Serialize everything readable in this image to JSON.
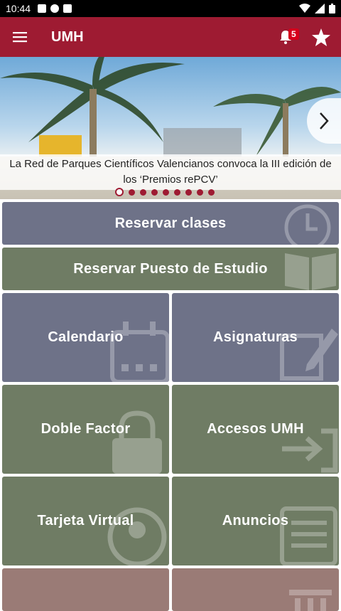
{
  "status_bar": {
    "time": "10:44"
  },
  "app_bar": {
    "title": "UMH",
    "notification_count": "5"
  },
  "carousel": {
    "caption": "La Red de Parques Científicos Valencianos convoca la III edición de los ‘Premios rePCV’",
    "dot_count": 9,
    "active_dot": 0
  },
  "tiles": {
    "reservar_clases": "Reservar clases",
    "reservar_puesto": "Reservar Puesto de Estudio",
    "calendario": "Calendario",
    "asignaturas": "Asignaturas",
    "doble_factor": "Doble Factor",
    "accesos_umh": "Accesos UMH",
    "tarjeta_virtual": "Tarjeta Virtual",
    "anuncios": "Anuncios"
  },
  "colors": {
    "primary": "#9e1b32",
    "slate": "#6e7288",
    "olive": "#6f7c64",
    "rose": "#9a7b76"
  }
}
